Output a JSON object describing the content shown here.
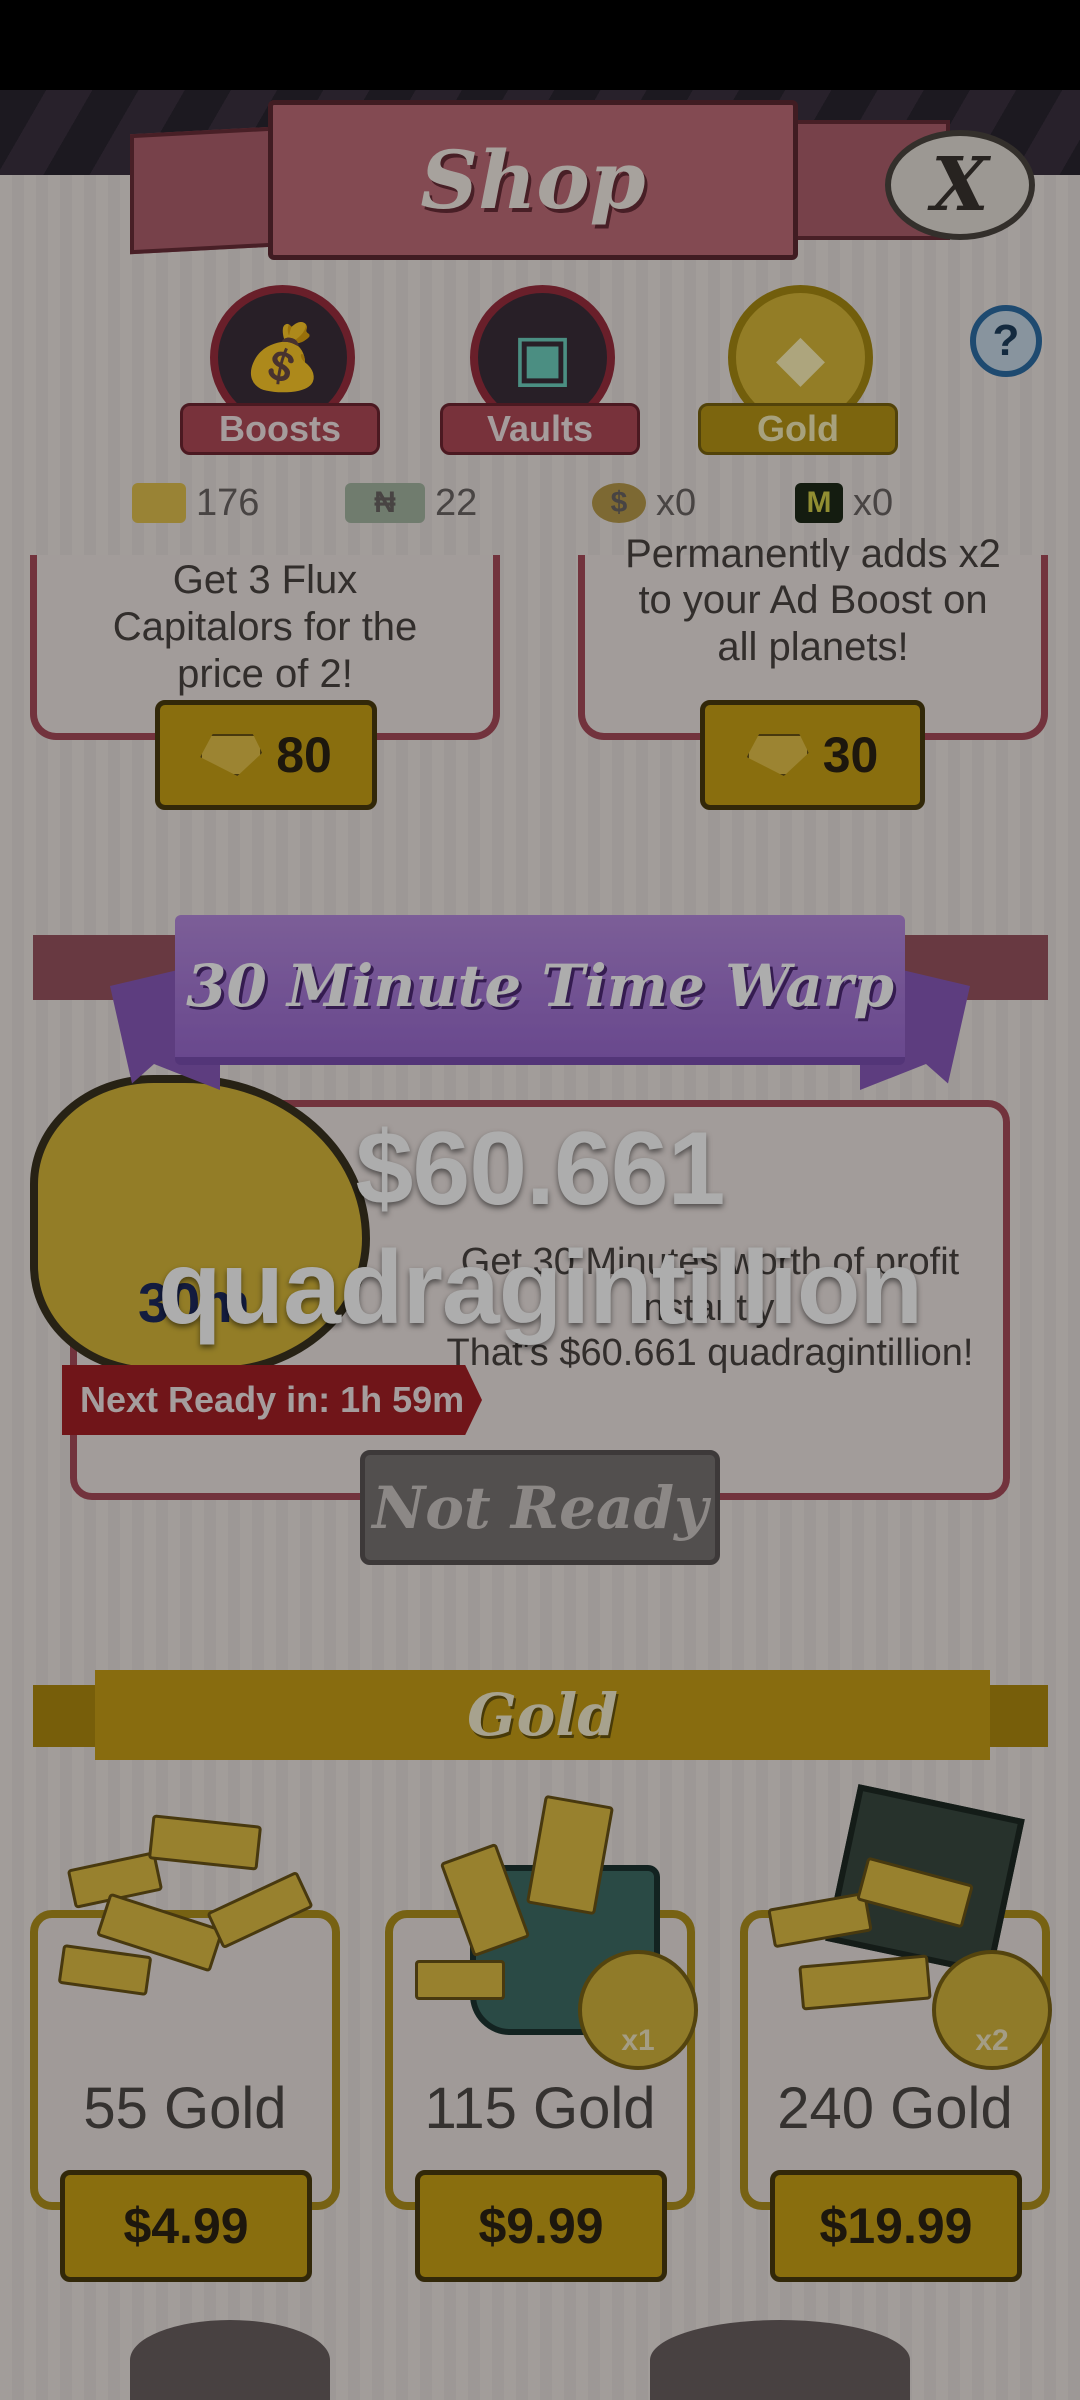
{
  "header": {
    "title": "Shop",
    "close_label": "X",
    "help_label": "?"
  },
  "tabs": [
    {
      "label": "Boosts",
      "icon": "boost-bag-icon"
    },
    {
      "label": "Vaults",
      "icon": "vault-safe-icon"
    },
    {
      "label": "Gold",
      "icon": "gold-nugget-icon",
      "active": true
    }
  ],
  "currencies": [
    {
      "icon": "gold-gem-icon",
      "value": "176"
    },
    {
      "icon": "ticket-icon",
      "value": "22"
    },
    {
      "icon": "money-bag-icon",
      "value": "x0"
    },
    {
      "icon": "mega-icon",
      "value": "x0"
    }
  ],
  "top_cards": [
    {
      "text": "Get 3 Flux Capitalors for the price of 2!",
      "price": "80"
    },
    {
      "text_partial": "Permanently adds x2",
      "text": "to your Ad Boost on all planets!",
      "price": "30"
    }
  ],
  "time_warp": {
    "title": "30 Minute Time Warp",
    "value": "$60.661 quadragintillion",
    "desc_line1": "Get 30 Minutes worth of profit",
    "desc_line2": "instantly!",
    "desc_line3": "That's $60.661 quadragintillion!",
    "clock_label": "30m",
    "next_ready": "Next Ready in: 1h 59m",
    "button": "Not Ready"
  },
  "gold_section": {
    "title": "Gold",
    "packs": [
      {
        "amount": "55 Gold",
        "price": "$4.99",
        "badge": ""
      },
      {
        "amount": "115 Gold",
        "price": "$9.99",
        "badge": "x1"
      },
      {
        "amount": "240 Gold",
        "price": "$19.99",
        "badge": "x2"
      }
    ]
  },
  "colors": {
    "accent_red": "#a94c5a",
    "gold": "#caa316",
    "purple_ribbon": "#9b6bd1"
  }
}
